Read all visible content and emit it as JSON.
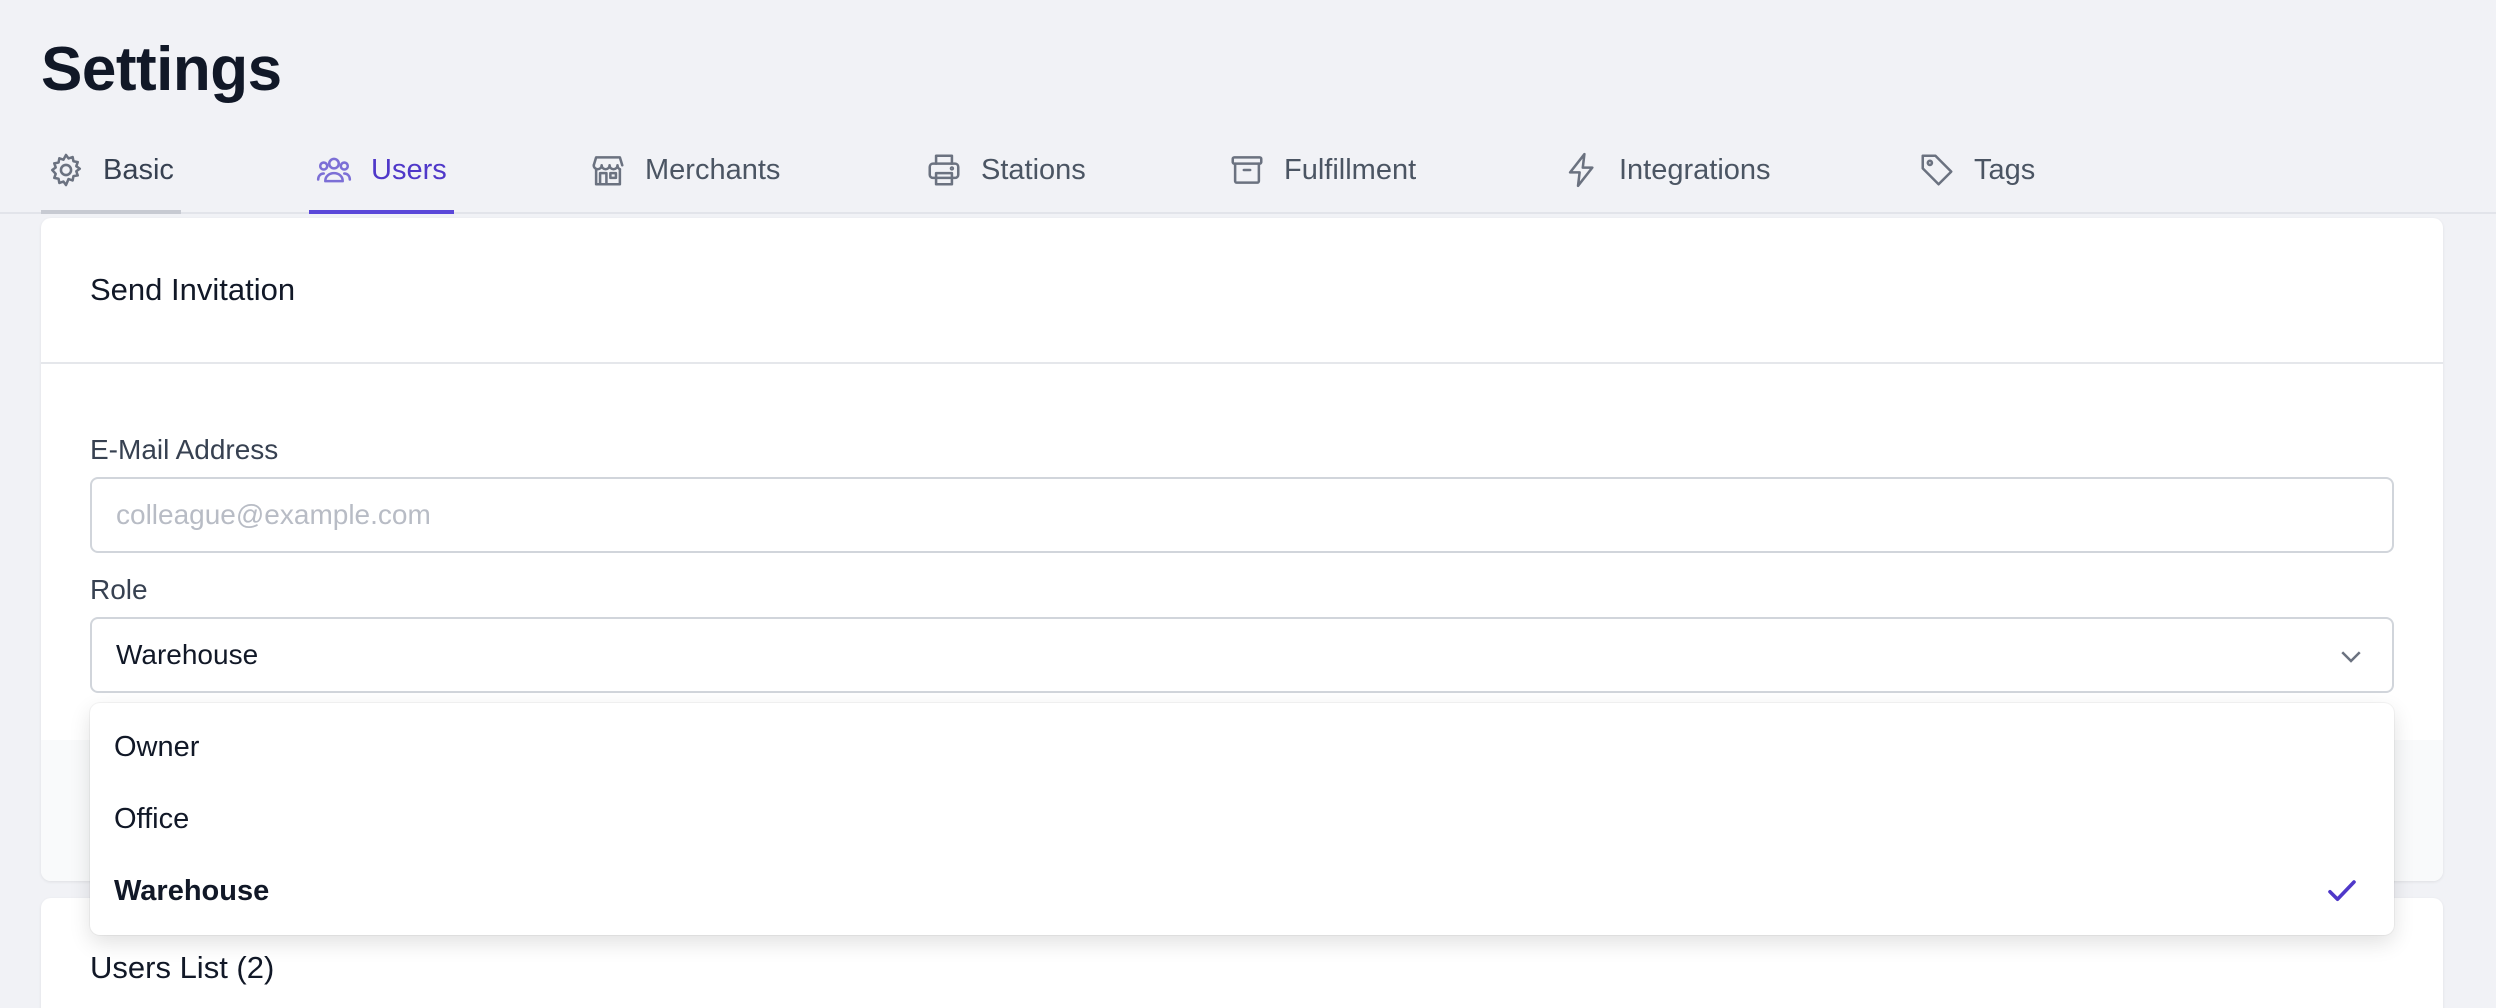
{
  "page": {
    "title": "Settings"
  },
  "tabs": [
    {
      "label": "Basic",
      "icon": "gear-icon"
    },
    {
      "label": "Users",
      "icon": "users-icon",
      "active": true
    },
    {
      "label": "Merchants",
      "icon": "storefront-icon"
    },
    {
      "label": "Stations",
      "icon": "printer-icon"
    },
    {
      "label": "Fulfillment",
      "icon": "archive-box-icon"
    },
    {
      "label": "Integrations",
      "icon": "lightning-bolt-icon"
    },
    {
      "label": "Tags",
      "icon": "tag-icon"
    }
  ],
  "invitation": {
    "title": "Send Invitation",
    "email_label": "E-Mail Address",
    "email_placeholder": "colleague@example.com",
    "email_value": "",
    "role_label": "Role",
    "role_value": "Warehouse",
    "role_options": [
      "Owner",
      "Office",
      "Warehouse"
    ]
  },
  "users_list": {
    "title": "Users List (2)"
  },
  "colors": {
    "accent": "#4f38c9",
    "background": "#f1f2f6"
  }
}
